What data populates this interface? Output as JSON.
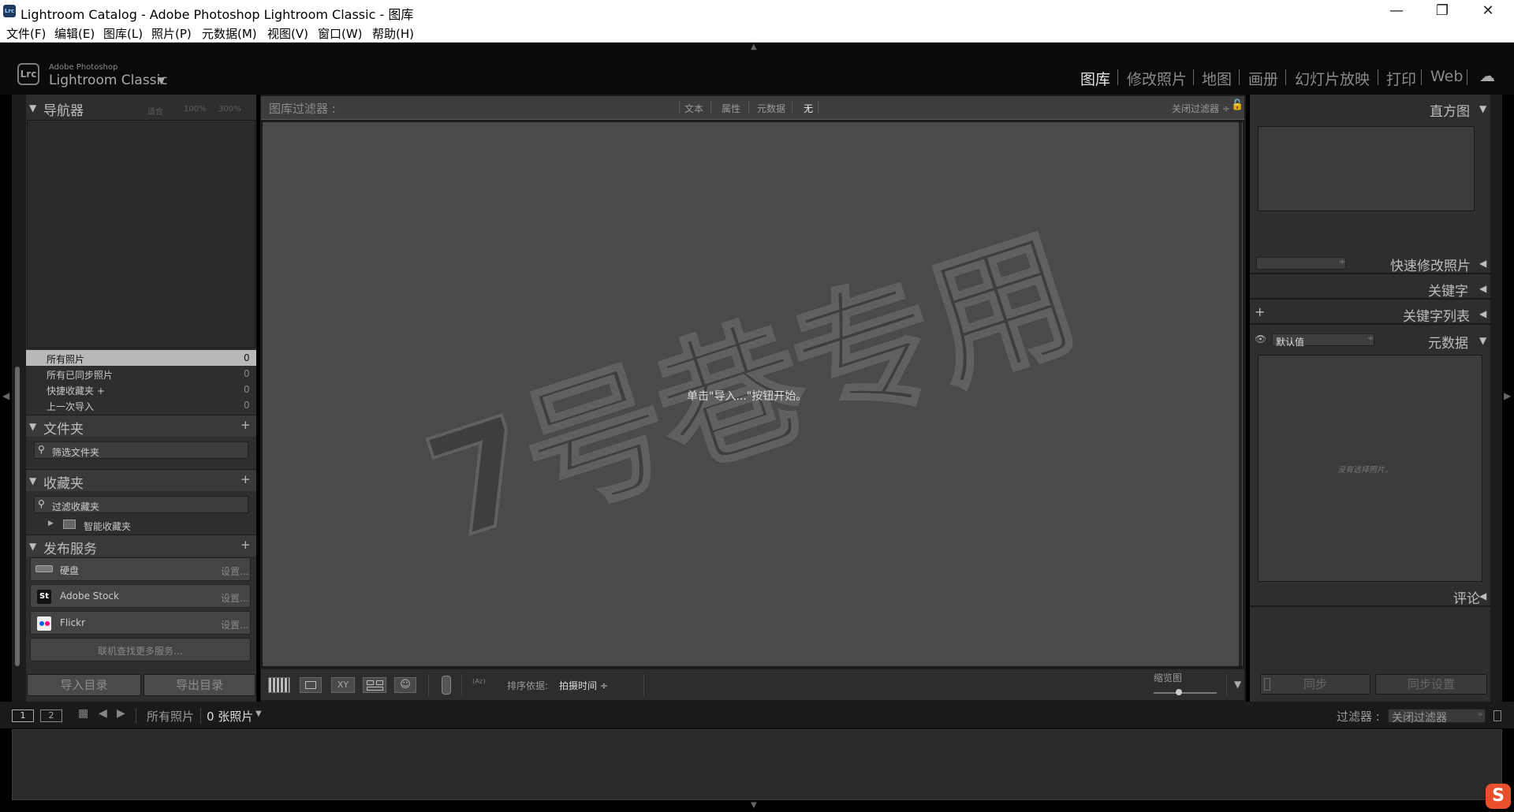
{
  "window": {
    "title": "Lightroom Catalog - Adobe Photoshop Lightroom Classic - 图库",
    "app_icon": "Lrc",
    "controls": [
      "—",
      "❐",
      "✕"
    ]
  },
  "menu": [
    "文件(F)",
    "编辑(E)",
    "图库(L)",
    "照片(P)",
    "元数据(M)",
    "视图(V)",
    "窗口(W)",
    "帮助(H)"
  ],
  "header": {
    "logo": "Lrc",
    "brand_small": "Adobe Photoshop",
    "brand_big": "Lightroom Classic",
    "modules": [
      "图库",
      "修改照片",
      "地图",
      "画册",
      "幻灯片放映",
      "打印",
      "Web"
    ]
  },
  "navigator": {
    "title": "导航器",
    "zoom": [
      "适合",
      "100%",
      "300%"
    ]
  },
  "catalog": [
    {
      "label": "所有照片",
      "count": "0"
    },
    {
      "label": "所有已同步照片",
      "count": "0"
    },
    {
      "label": "快捷收藏夹 +",
      "count": "0"
    },
    {
      "label": "上一次导入",
      "count": "0"
    }
  ],
  "folders": {
    "title": "文件夹",
    "search_placeholder": "筛选文件夹"
  },
  "collections": {
    "title": "收藏夹",
    "search_placeholder": "过滤收藏夹",
    "smart": "智能收藏夹"
  },
  "publish": {
    "title": "发布服务",
    "services": [
      {
        "name": "硬盘",
        "action": "设置..."
      },
      {
        "name": "Adobe Stock",
        "action": "设置..."
      },
      {
        "name": "Flickr",
        "action": "设置..."
      }
    ],
    "find_more": "联机查找更多服务..."
  },
  "left_buttons": {
    "import": "导入目录",
    "export": "导出目录"
  },
  "filter": {
    "title": "图库过滤器 :",
    "options": [
      "文本",
      "属性",
      "元数据",
      "无"
    ],
    "preset": "关闭过滤器 ÷"
  },
  "center": {
    "message": "单击\"导入...\"按钮开始。",
    "watermark": "7号巷专用"
  },
  "toolbar": {
    "sort_label": "排序依据:",
    "sort_value": "拍摄时间 ÷",
    "thumb_label": "缩览图"
  },
  "right": {
    "histogram": "直方图",
    "quick_develop": "快速修改照片",
    "keywording": "关键字",
    "keyword_list": "关键字列表",
    "metadata": "元数据",
    "metadata_preset": "默认值",
    "no_selection": "没有选择照片。",
    "comments": "评论",
    "sync": "同步",
    "sync_settings": "同步设置"
  },
  "filmbar": {
    "screen1": "1",
    "screen2": "2",
    "source": "所有照片",
    "count": "0 张照片",
    "filter_label": "过滤器 :",
    "filter_value": "关闭过滤器"
  }
}
